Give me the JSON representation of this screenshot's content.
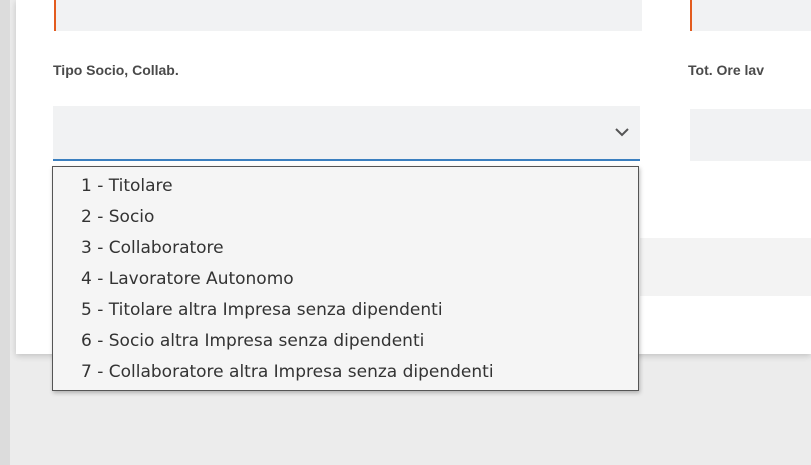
{
  "form": {
    "tipo_socio_label": "Tipo Socio, Collab.",
    "tot_ore_label": "Tot. Ore lav",
    "tipo_socio_value": ""
  },
  "dropdown": {
    "options": [
      "1 - Titolare",
      "2 - Socio",
      "3 - Collaboratore",
      "4 - Lavoratore Autonomo",
      "5 - Titolare altra Impresa senza dipendenti",
      "6 - Socio altra Impresa senza dipendenti",
      "7 - Collaboratore altra Impresa senza dipendenti"
    ]
  },
  "icons": {
    "select_arrow": "chevron-down-icon"
  },
  "colors": {
    "accent_orange": "#e35b1e",
    "focus_blue": "#3b7fbf",
    "label_text": "#4a4a4a",
    "field_bg": "#f1f2f3"
  }
}
